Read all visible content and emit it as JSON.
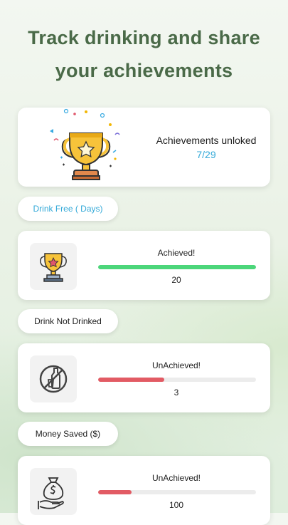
{
  "headline": {
    "line1": "Track drinking and share",
    "line2": "your achievements"
  },
  "summary": {
    "title": "Achievements unloked",
    "count": "7/29",
    "icon": "trophy-icon"
  },
  "sections": [
    {
      "pill_label": "Drink Free ( Days)",
      "pill_color": "#33a9d8",
      "icon": "trophy-icon",
      "status": "Achieved!",
      "value": "20",
      "progress": 1.0,
      "bar_color": "#4cd67a"
    },
    {
      "pill_label": "Drink Not Drinked",
      "pill_color": "#1d1d1d",
      "icon": "no-drinking-icon",
      "status": "UnAchieved!",
      "value": "3",
      "progress": 0.42,
      "bar_color": "#e25b64"
    },
    {
      "pill_label": "Money Saved ($)",
      "pill_color": "#1d1d1d",
      "icon": "money-bag-hand-icon",
      "status": "UnAchieved!",
      "value": "100",
      "progress": 0.21,
      "bar_color": "#e25b64"
    }
  ],
  "colors": {
    "headline": "#4a6a48",
    "accent_blue": "#33a9d8",
    "achieved_green": "#4cd67a",
    "unachieved_red": "#e25b64"
  }
}
